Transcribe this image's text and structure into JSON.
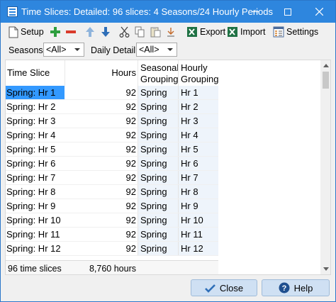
{
  "window": {
    "title": "Time Slices: Detailed: 96 slices: 4 Seasons/24 Hourly Periods"
  },
  "toolbar": {
    "setup_label": "Setup",
    "export_label": "Export",
    "import_label": "Import",
    "settings_label": "Settings"
  },
  "filters": {
    "seasons_label": "Seasons:",
    "seasons_value": "<All>",
    "daily_label": "Daily Detail:",
    "daily_value": "<All>"
  },
  "table": {
    "headers": {
      "slice": "Time Slice",
      "hours": "Hours",
      "season_line1": "Seasonal",
      "season_line2": "Grouping",
      "hourly_line1": "Hourly",
      "hourly_line2": "Grouping"
    },
    "rows": [
      {
        "slice": "Spring: Hr 1",
        "hours": "92",
        "season": "Spring",
        "hourly": "Hr 1"
      },
      {
        "slice": "Spring: Hr 2",
        "hours": "92",
        "season": "Spring",
        "hourly": "Hr 2"
      },
      {
        "slice": "Spring: Hr 3",
        "hours": "92",
        "season": "Spring",
        "hourly": "Hr 3"
      },
      {
        "slice": "Spring: Hr 4",
        "hours": "92",
        "season": "Spring",
        "hourly": "Hr 4"
      },
      {
        "slice": "Spring: Hr 5",
        "hours": "92",
        "season": "Spring",
        "hourly": "Hr 5"
      },
      {
        "slice": "Spring: Hr 6",
        "hours": "92",
        "season": "Spring",
        "hourly": "Hr 6"
      },
      {
        "slice": "Spring: Hr 7",
        "hours": "92",
        "season": "Spring",
        "hourly": "Hr 7"
      },
      {
        "slice": "Spring: Hr 8",
        "hours": "92",
        "season": "Spring",
        "hourly": "Hr 8"
      },
      {
        "slice": "Spring: Hr 9",
        "hours": "92",
        "season": "Spring",
        "hourly": "Hr 9"
      },
      {
        "slice": "Spring: Hr 10",
        "hours": "92",
        "season": "Spring",
        "hourly": "Hr 10"
      },
      {
        "slice": "Spring: Hr 11",
        "hours": "92",
        "season": "Spring",
        "hourly": "Hr 11"
      },
      {
        "slice": "Spring: Hr 12",
        "hours": "92",
        "season": "Spring",
        "hourly": "Hr 12"
      }
    ],
    "footer": {
      "count": "96 time slices",
      "total": "8,760 hours"
    }
  },
  "buttons": {
    "close_label": "Close",
    "help_label": "Help"
  },
  "colors": {
    "titlebar": "#2e86de",
    "selection": "#3399ff",
    "button_bg": "#cfe0f3",
    "add_green": "#2e9e3e",
    "remove_red": "#d93a2b",
    "arrow_blue": "#2f6fb8",
    "excel_green": "#1f7244"
  }
}
